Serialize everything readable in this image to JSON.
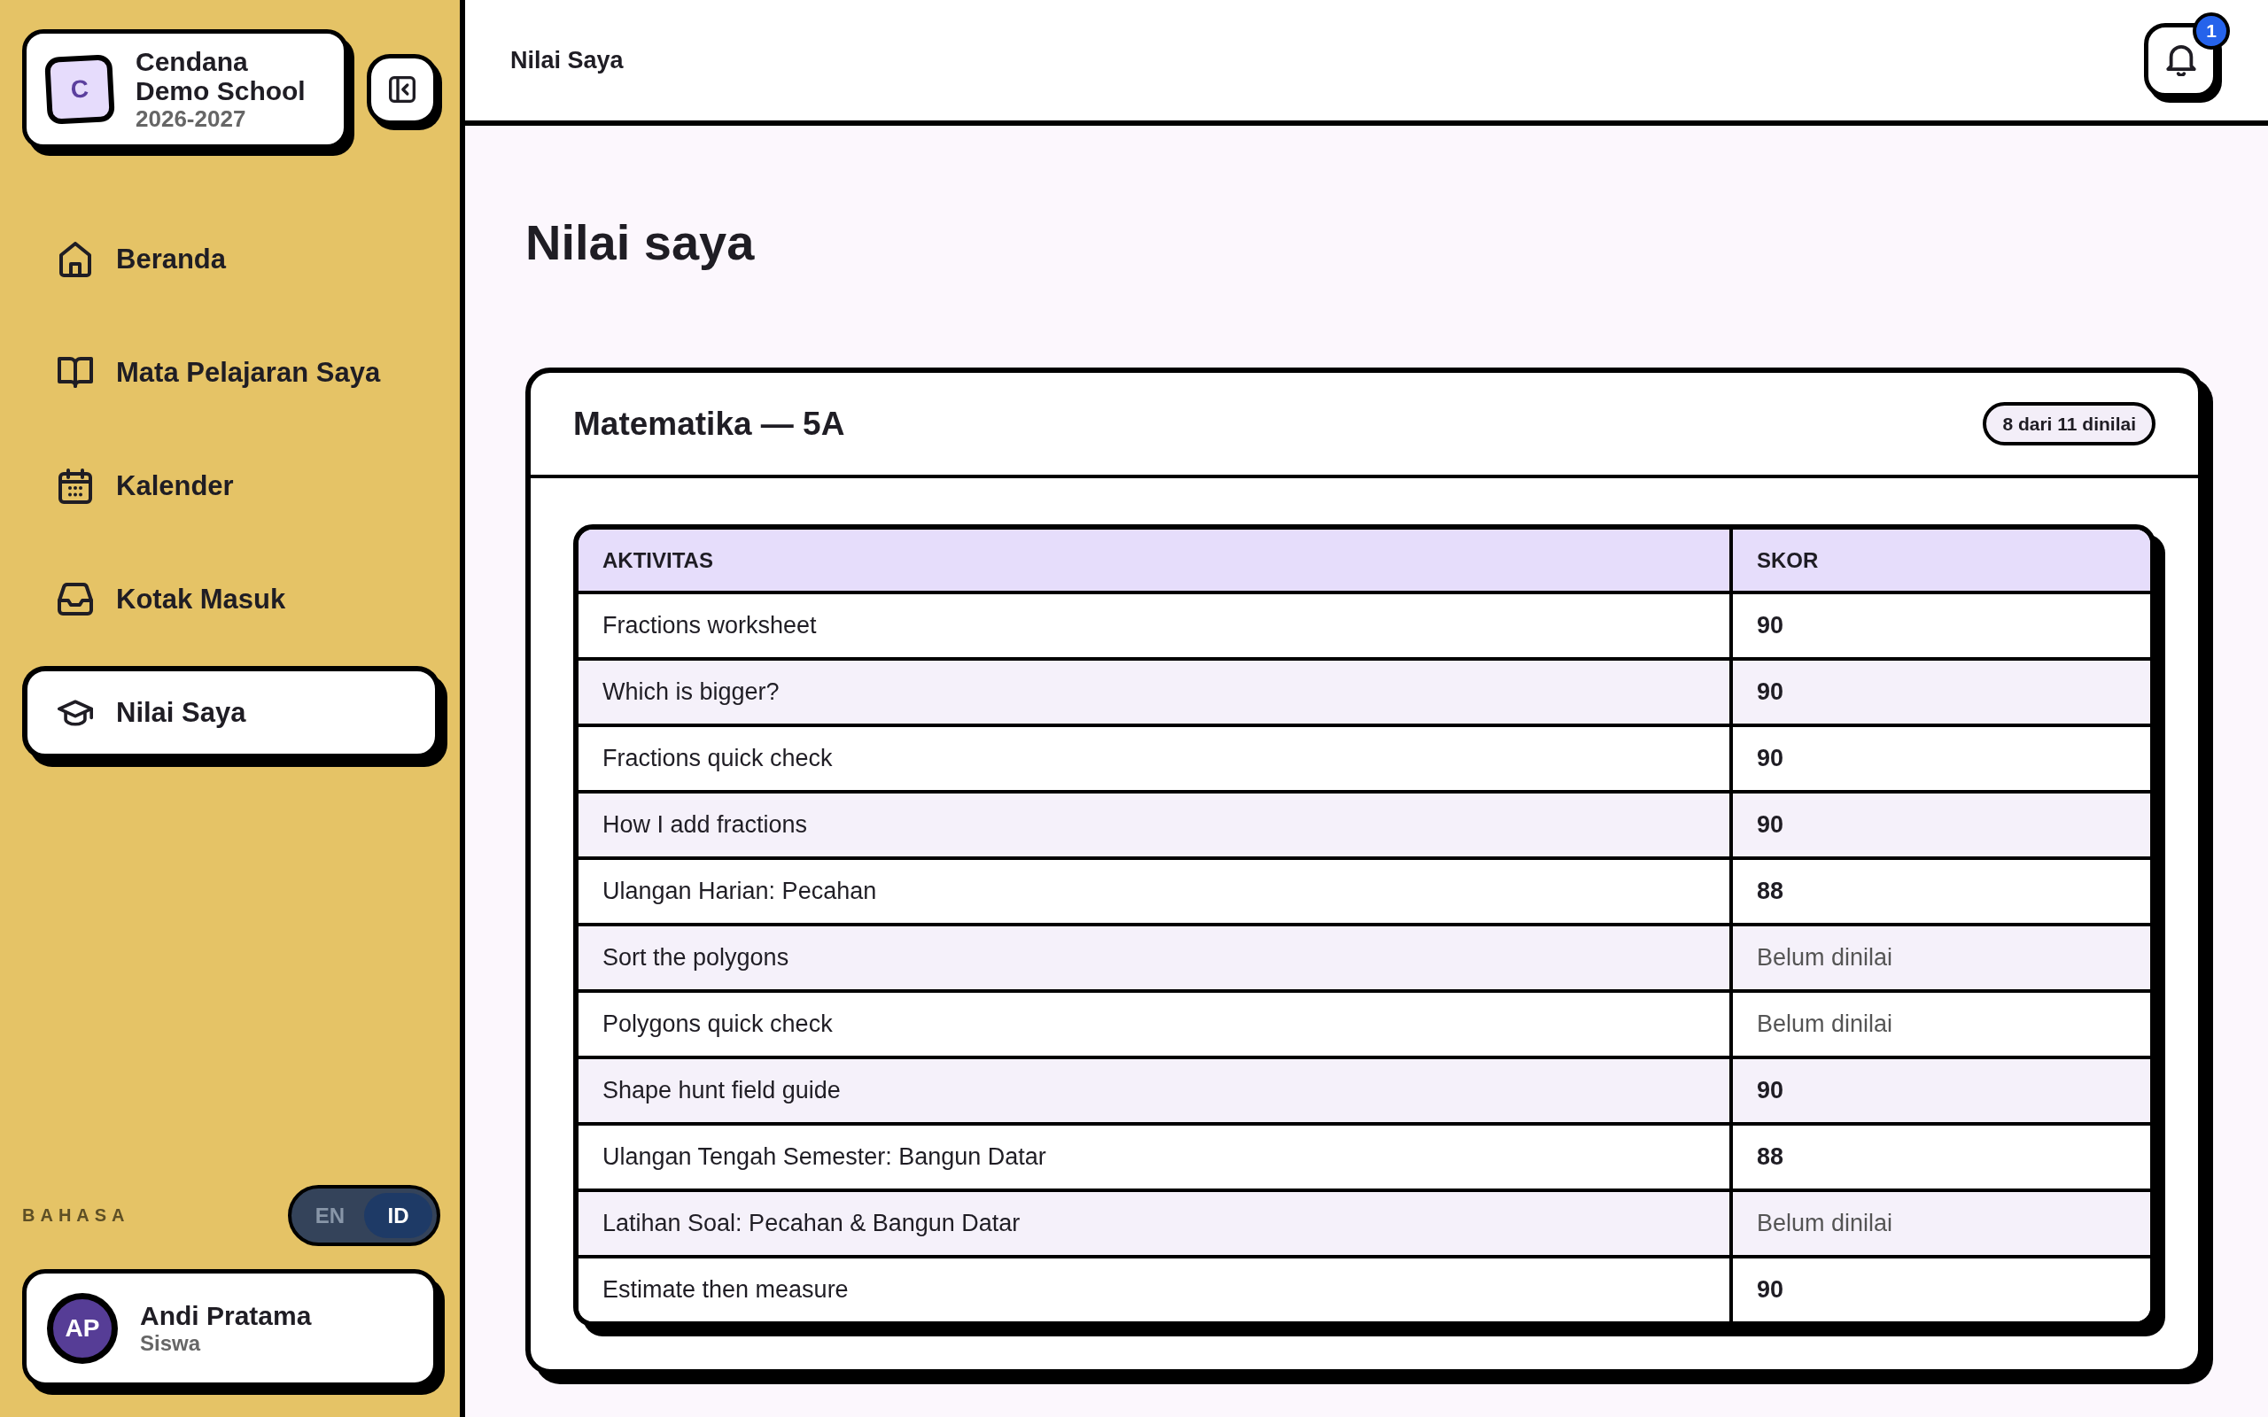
{
  "sidebar": {
    "school": {
      "initial": "C",
      "name": "Cendana Demo School",
      "year": "2026-2027"
    },
    "nav_items": [
      {
        "label": "Beranda",
        "selected": false
      },
      {
        "label": "Mata Pelajaran Saya",
        "selected": false
      },
      {
        "label": "Kalender",
        "selected": false
      },
      {
        "label": "Kotak Masuk",
        "selected": false
      },
      {
        "label": "Nilai Saya",
        "selected": true
      }
    ],
    "language": {
      "label": "BAHASA",
      "options": [
        {
          "label": "EN",
          "selected": false
        },
        {
          "label": "ID",
          "selected": true
        }
      ]
    },
    "user": {
      "initials": "AP",
      "name": "Andi Pratama",
      "role": "Siswa"
    }
  },
  "top_bar": {
    "title": "Nilai Saya",
    "notification_count": "1"
  },
  "page_title": "Nilai saya",
  "card": {
    "title": "Matematika — 5A",
    "badge": "8 dari 11 dinilai",
    "table": {
      "columns": [
        "AKTIVITAS",
        "SKOR"
      ],
      "rows": [
        {
          "activity": "Fractions worksheet",
          "score": "90",
          "graded": true
        },
        {
          "activity": "Which is bigger?",
          "score": "90",
          "graded": true
        },
        {
          "activity": "Fractions quick check",
          "score": "90",
          "graded": true
        },
        {
          "activity": "How I add fractions",
          "score": "90",
          "graded": true
        },
        {
          "activity": "Ulangan Harian: Pecahan",
          "score": "88",
          "graded": true
        },
        {
          "activity": "Sort the polygons",
          "score": "Belum dinilai",
          "graded": false
        },
        {
          "activity": "Polygons quick check",
          "score": "Belum dinilai",
          "graded": false
        },
        {
          "activity": "Shape hunt field guide",
          "score": "90",
          "graded": true
        },
        {
          "activity": "Ulangan Tengah Semester: Bangun Datar",
          "score": "88",
          "graded": true
        },
        {
          "activity": "Latihan Soal: Pecahan & Bangun Datar",
          "score": "Belum dinilai",
          "graded": false
        },
        {
          "activity": "Estimate then measure",
          "score": "90",
          "graded": true
        }
      ]
    }
  }
}
